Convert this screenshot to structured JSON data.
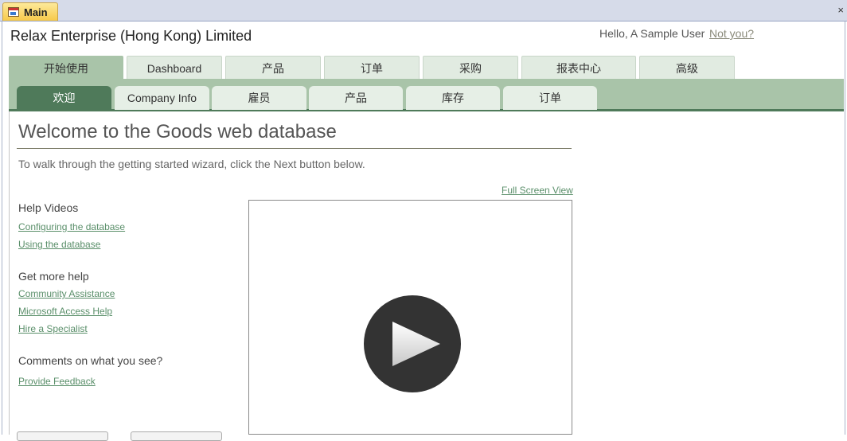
{
  "document_tab": {
    "label": "Main",
    "icon": "form-icon"
  },
  "close_icon": "×",
  "header": {
    "company": "Relax Enterprise (Hong Kong) Limited",
    "greeting": "Hello, A Sample User",
    "not_you": "Not you?"
  },
  "top_tabs": [
    {
      "label": "开始使用",
      "active": true
    },
    {
      "label": "Dashboard",
      "active": false
    },
    {
      "label": "产品",
      "active": false
    },
    {
      "label": "订单",
      "active": false
    },
    {
      "label": "采购",
      "active": false
    },
    {
      "label": "报表中心",
      "active": false
    },
    {
      "label": "高级",
      "active": false
    }
  ],
  "sub_tabs": [
    {
      "label": "欢迎",
      "active": true
    },
    {
      "label": "Company Info",
      "active": false
    },
    {
      "label": "雇员",
      "active": false
    },
    {
      "label": "产品",
      "active": false
    },
    {
      "label": "库存",
      "active": false
    },
    {
      "label": "订单",
      "active": false
    }
  ],
  "main": {
    "title": "Welcome to the Goods web database",
    "intro": "To walk through the getting started wizard, click the Next button below.",
    "full_screen": "Full Screen View",
    "help_videos": {
      "heading": "Help Videos",
      "links": [
        "Configuring the database",
        "Using the database"
      ]
    },
    "more_help": {
      "heading": "Get more help",
      "links": [
        "Community Assistance",
        "Microsoft Access Help",
        "Hire a Specialist"
      ]
    },
    "comments": {
      "heading": "Comments on what you see?",
      "link": "Provide Feedback"
    },
    "video": {
      "play_icon": "play-icon"
    }
  },
  "colors": {
    "accent_dark": "#4f7a5a",
    "accent_light": "#a9c4a9",
    "tab_bg": "#e1ebe1",
    "link": "#5a8f6a"
  }
}
